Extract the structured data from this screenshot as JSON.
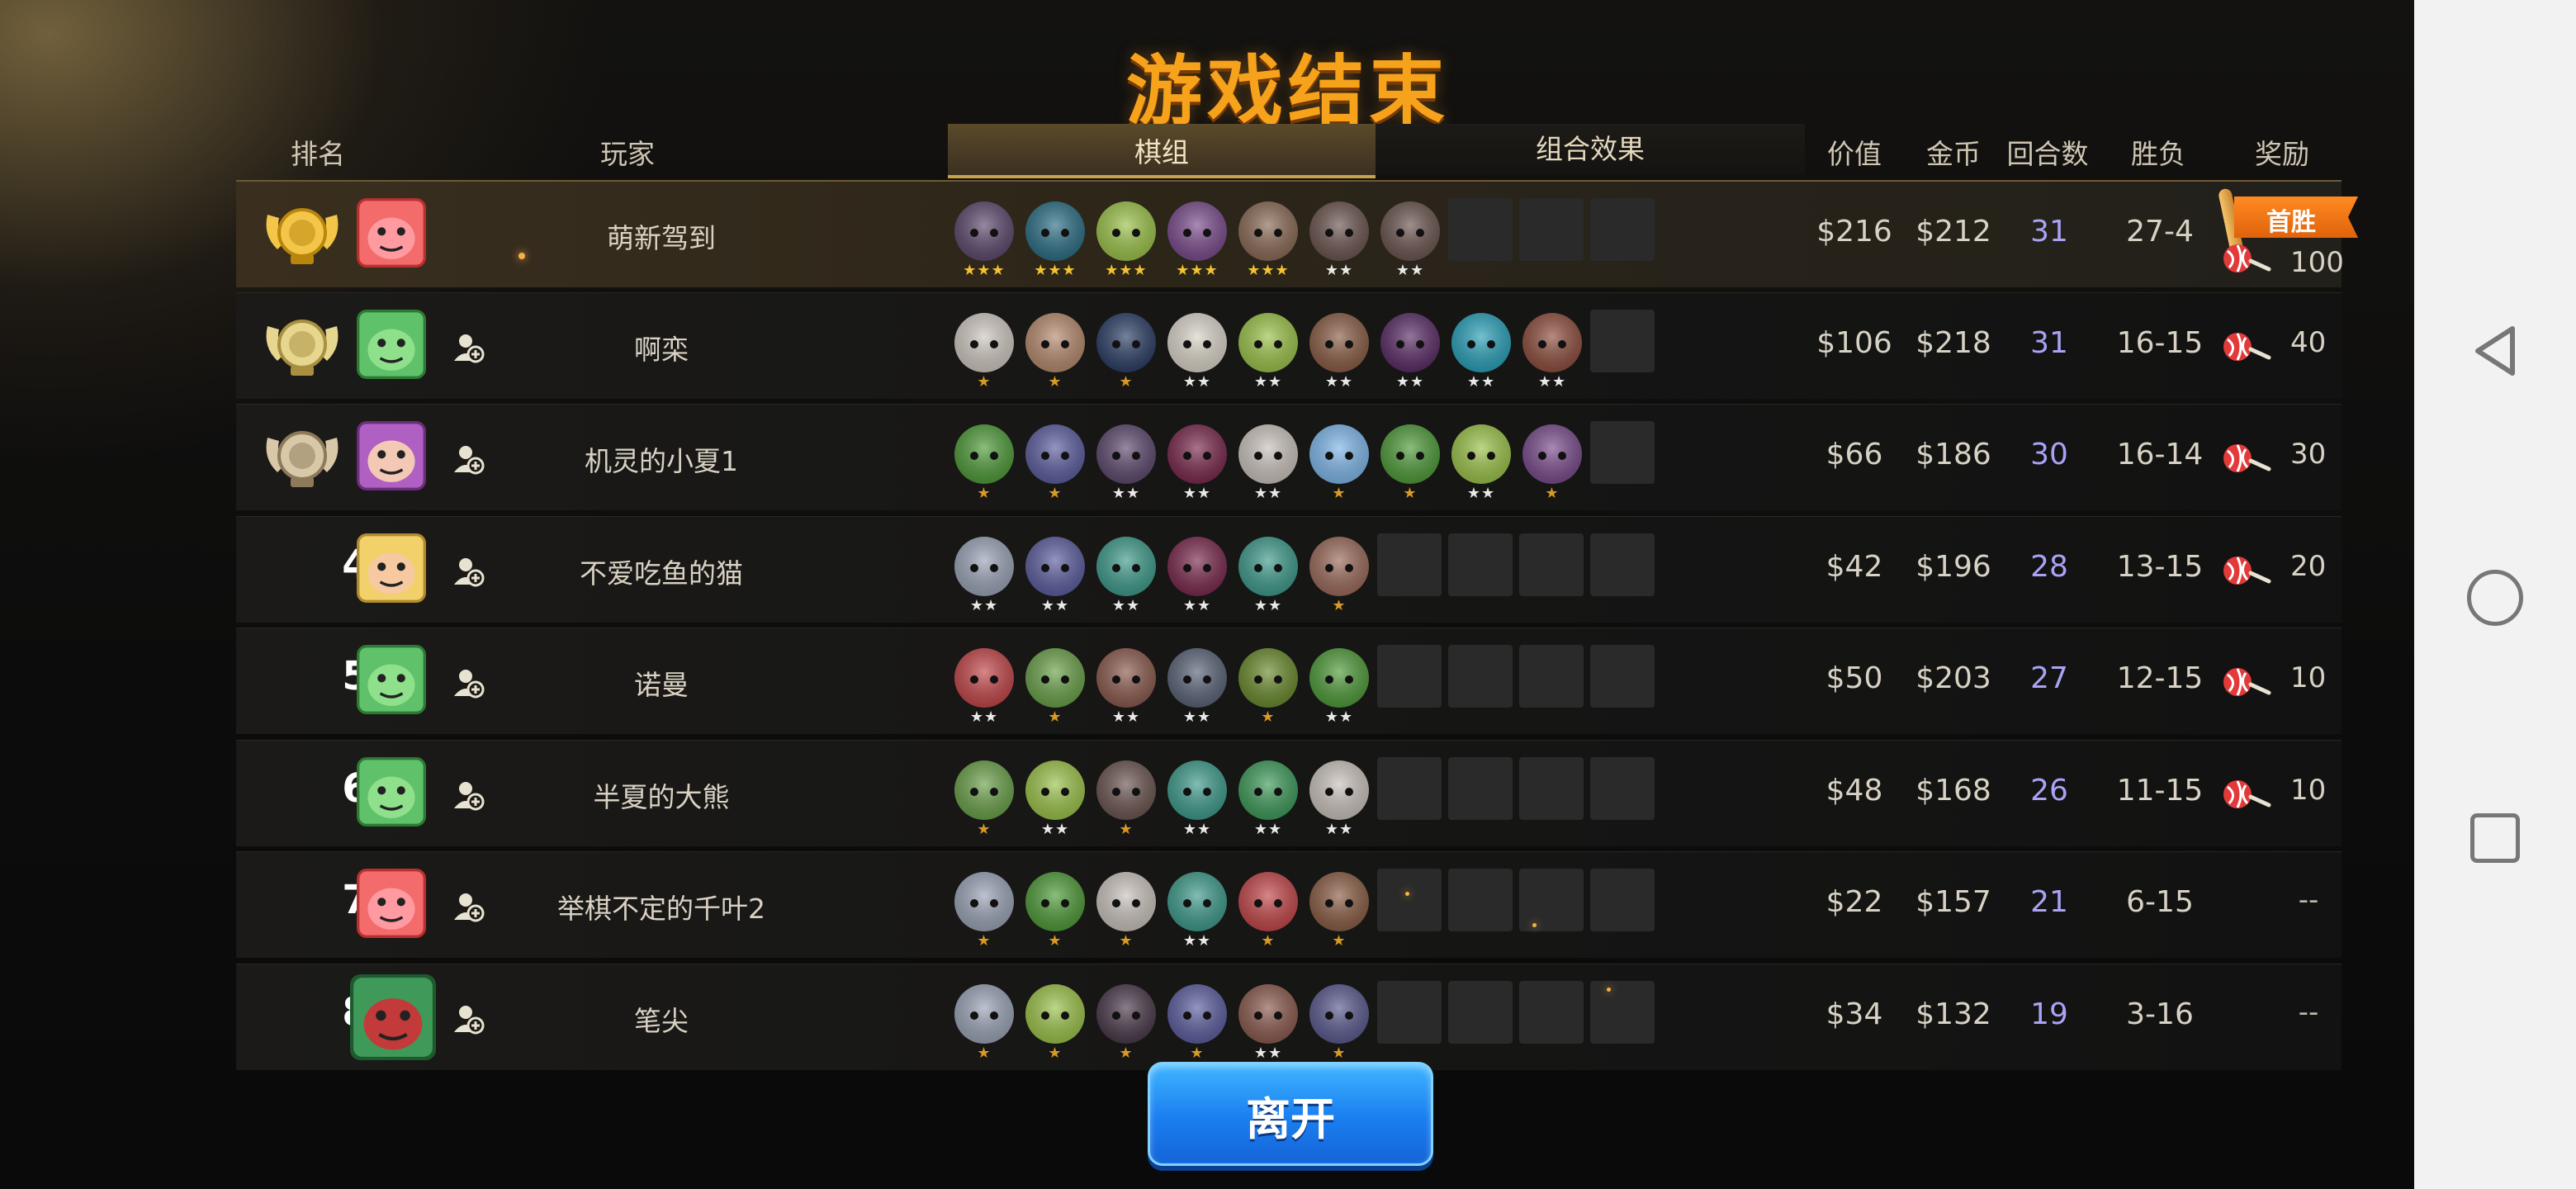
{
  "title": "游戏结束",
  "headers": {
    "rank": "排名",
    "player": "玩家",
    "lineup_tab": "棋组",
    "synergy_tab": "组合效果",
    "value": "价值",
    "gold": "金币",
    "rounds": "回合数",
    "win_loss": "胜负",
    "reward": "奖励"
  },
  "first_win_label": "首胜",
  "leave_label": "离开",
  "colors": {
    "title": "#f7a21b",
    "rounds": "#a9a3f5",
    "leave_button": "#1a7ef0",
    "first_win": "#e0620b"
  },
  "rows": [
    {
      "rank": "",
      "rank_icon": "gold-medal-icon",
      "player": "萌新驾到",
      "avatar": "red-pig-avatar",
      "units": [
        {
          "stars": "★★★",
          "color": "#5d4a6e"
        },
        {
          "stars": "★★★",
          "color": "#2c6f86"
        },
        {
          "stars": "★★★",
          "color": "#9bc24a"
        },
        {
          "stars": "★★★",
          "color": "#7a4c8c"
        },
        {
          "stars": "★★★",
          "color": "#8a6a56"
        },
        {
          "stars": "★★",
          "color": "#6b5550"
        },
        {
          "stars": "★★",
          "color": "#6b5550"
        }
      ],
      "value": "$216",
      "gold": "$212",
      "rounds": "31",
      "record": "27-4",
      "reward": "100",
      "first_win": true
    },
    {
      "rank": "",
      "rank_icon": "silver-medal-icon",
      "player": "啊栾",
      "avatar": "green-orc-avatar",
      "units": [
        {
          "stars": "★",
          "color": "#cfc7c0"
        },
        {
          "stars": "★",
          "color": "#b58a6e"
        },
        {
          "stars": "★",
          "color": "#2d3f66"
        },
        {
          "stars": "★★",
          "color": "#d9d4c8"
        },
        {
          "stars": "★★",
          "color": "#9bc24a"
        },
        {
          "stars": "★★",
          "color": "#8a5d45"
        },
        {
          "stars": "★★",
          "color": "#5a2e66"
        },
        {
          "stars": "★★",
          "color": "#2aa0b8"
        },
        {
          "stars": "★★",
          "color": "#8e4e3e"
        }
      ],
      "value": "$106",
      "gold": "$218",
      "rounds": "31",
      "record": "16-15",
      "reward": "40",
      "first_win": false
    },
    {
      "rank": "",
      "rank_icon": "bronze-medal-icon",
      "player": "机灵的小夏1",
      "avatar": "purple-hair-girl-avatar",
      "units": [
        {
          "stars": "★",
          "color": "#4f9a3a"
        },
        {
          "stars": "★",
          "color": "#5c5e9e"
        },
        {
          "stars": "★★",
          "color": "#5d4a6e"
        },
        {
          "stars": "★★",
          "color": "#7a2a4e"
        },
        {
          "stars": "★★",
          "color": "#c9c2bb"
        },
        {
          "stars": "★",
          "color": "#7fb6e8"
        },
        {
          "stars": "★",
          "color": "#4f9a3a"
        },
        {
          "stars": "★★",
          "color": "#9bc24a"
        },
        {
          "stars": "★",
          "color": "#7a4c8c"
        }
      ],
      "value": "$66",
      "gold": "$186",
      "rounds": "30",
      "record": "16-14",
      "reward": "30",
      "first_win": false
    },
    {
      "rank": "4",
      "rank_icon": "",
      "player": "不爱吃鱼的猫",
      "avatar": "blond-elf-avatar",
      "units": [
        {
          "stars": "★★",
          "color": "#9aa3b5"
        },
        {
          "stars": "★★",
          "color": "#5c5e9e"
        },
        {
          "stars": "★★",
          "color": "#3f9a8a"
        },
        {
          "stars": "★★",
          "color": "#7a2a4e"
        },
        {
          "stars": "★★",
          "color": "#3f9a8a"
        },
        {
          "stars": "★",
          "color": "#9a6a5a"
        }
      ],
      "value": "$42",
      "gold": "$196",
      "rounds": "28",
      "record": "13-15",
      "reward": "20",
      "first_win": false
    },
    {
      "rank": "5",
      "rank_icon": "",
      "player": "诺曼",
      "avatar": "green-orc-avatar",
      "units": [
        {
          "stars": "★★",
          "color": "#c2474a"
        },
        {
          "stars": "★",
          "color": "#6aa04a"
        },
        {
          "stars": "★★",
          "color": "#8a5a4e"
        },
        {
          "stars": "★★",
          "color": "#5a6478"
        },
        {
          "stars": "★",
          "color": "#6a8a2e"
        },
        {
          "stars": "★★",
          "color": "#4f9a3a"
        }
      ],
      "value": "$50",
      "gold": "$203",
      "rounds": "27",
      "record": "12-15",
      "reward": "10",
      "first_win": false
    },
    {
      "rank": "6",
      "rank_icon": "",
      "player": "半夏的大熊",
      "avatar": "green-orc-avatar",
      "units": [
        {
          "stars": "★",
          "color": "#6aa04a"
        },
        {
          "stars": "★★",
          "color": "#9bc24a"
        },
        {
          "stars": "★",
          "color": "#6b5550"
        },
        {
          "stars": "★★",
          "color": "#3f9a8a"
        },
        {
          "stars": "★★",
          "color": "#3f9a5a"
        },
        {
          "stars": "★★",
          "color": "#c9c2bb"
        }
      ],
      "value": "$48",
      "gold": "$168",
      "rounds": "26",
      "record": "11-15",
      "reward": "10",
      "first_win": false
    },
    {
      "rank": "7",
      "rank_icon": "",
      "player": "举棋不定的千叶2",
      "avatar": "red-pig-avatar",
      "units": [
        {
          "stars": "★",
          "color": "#9aa3b5"
        },
        {
          "stars": "★",
          "color": "#4f9a3a"
        },
        {
          "stars": "★",
          "color": "#c9c2bb"
        },
        {
          "stars": "★★",
          "color": "#3f9a8a"
        },
        {
          "stars": "★",
          "color": "#c2474a"
        },
        {
          "stars": "★",
          "color": "#8a5d45"
        }
      ],
      "value": "$22",
      "gold": "$157",
      "rounds": "21",
      "record": "6-15",
      "reward": "--",
      "first_win": false
    },
    {
      "rank": "8",
      "rank_icon": "",
      "player": "笔尖",
      "avatar": "frog-king-avatar",
      "units": [
        {
          "stars": "★",
          "color": "#9aa3b5"
        },
        {
          "stars": "★",
          "color": "#9bc24a"
        },
        {
          "stars": "★",
          "color": "#4a3a4a"
        },
        {
          "stars": "★",
          "color": "#5c5e9e"
        },
        {
          "stars": "★★",
          "color": "#8a5a4e"
        },
        {
          "stars": "★",
          "color": "#5a5a8e"
        }
      ],
      "value": "$34",
      "gold": "$132",
      "rounds": "19",
      "record": "3-16",
      "reward": "--",
      "first_win": false
    }
  ]
}
